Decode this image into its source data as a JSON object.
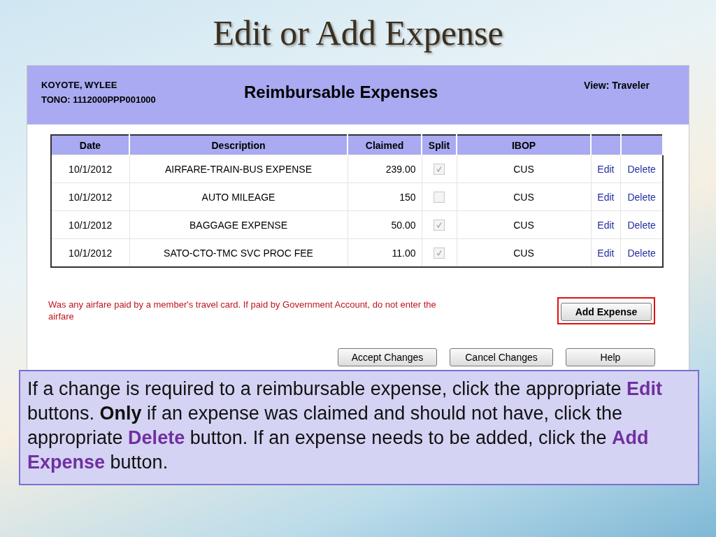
{
  "slide_title": "Edit or Add Expense",
  "header": {
    "name": "KOYOTE, WYLEE",
    "tono": "TONO: 1112000PPP001000",
    "title": "Reimbursable Expenses",
    "view": "View:  Traveler"
  },
  "table": {
    "columns": [
      "Date",
      "Description",
      "Claimed",
      "Split",
      "IBOP"
    ],
    "rows": [
      {
        "date": "10/1/2012",
        "description": "AIRFARE-TRAIN-BUS EXPENSE",
        "claimed": "239.00",
        "split": true,
        "ibop": "CUS",
        "edit": "Edit",
        "delete": "Delete"
      },
      {
        "date": "10/1/2012",
        "description": "AUTO MILEAGE",
        "claimed": "150",
        "split": false,
        "ibop": "CUS",
        "edit": "Edit",
        "delete": "Delete"
      },
      {
        "date": "10/1/2012",
        "description": "BAGGAGE EXPENSE",
        "claimed": "50.00",
        "split": true,
        "ibop": "CUS",
        "edit": "Edit",
        "delete": "Delete"
      },
      {
        "date": "10/1/2012",
        "description": "SATO-CTO-TMC SVC PROC FEE",
        "claimed": "11.00",
        "split": true,
        "ibop": "CUS",
        "edit": "Edit",
        "delete": "Delete"
      }
    ]
  },
  "warning": "Was any airfare paid by a member's travel card. If paid by Government Account, do not enter the airfare",
  "add_button": {
    "label": "Add Expense",
    "highlighted": true
  },
  "buttons": [
    "Accept Changes",
    "Cancel Changes",
    "Help"
  ],
  "callout": [
    {
      "kind": "plain",
      "text": "If a change is required to a reimbursable expense, click the appropriate "
    },
    {
      "kind": "keyword",
      "text": "Edit"
    },
    {
      "kind": "plain",
      "text": " buttons. "
    },
    {
      "kind": "bold",
      "text": "Only"
    },
    {
      "kind": "plain",
      "text": " if an expense was claimed and should not have, click the appropriate "
    },
    {
      "kind": "keyword",
      "text": "Delete"
    },
    {
      "kind": "plain",
      "text": " button. If an expense needs to be added, click the "
    },
    {
      "kind": "keyword",
      "text": "Add Expense"
    },
    {
      "kind": "plain",
      "text": " button."
    }
  ]
}
